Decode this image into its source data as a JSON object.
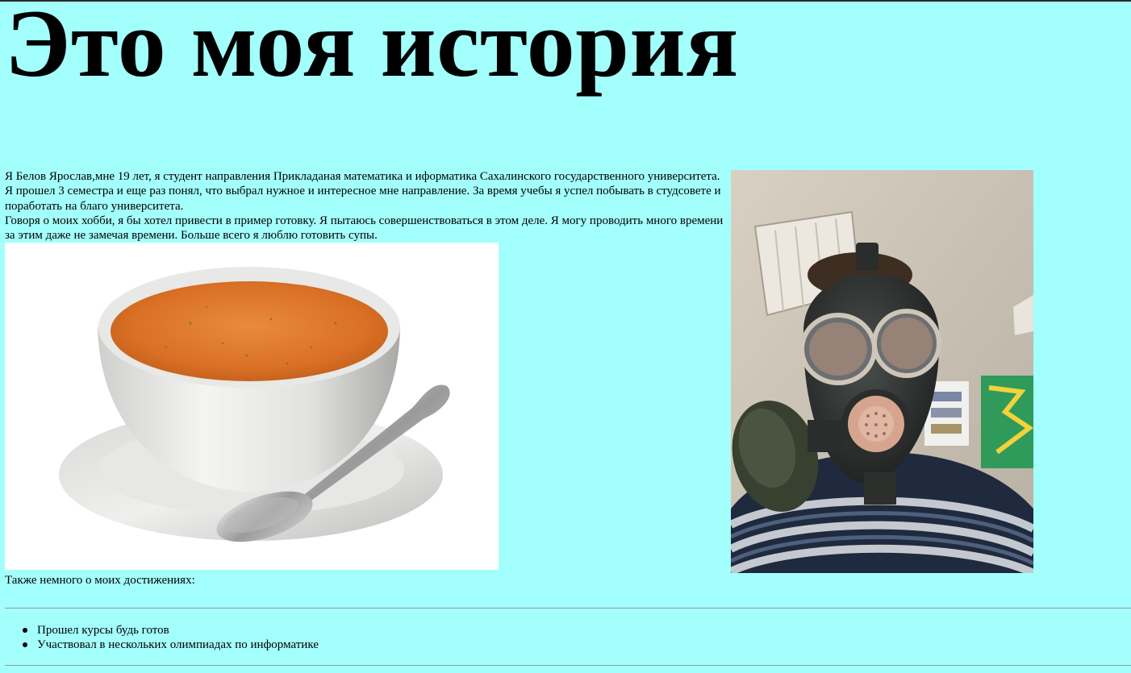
{
  "page": {
    "title": "Это моя история",
    "intro_paragraph_1": "Я Белов Ярослав,мне 19 лет, я студент направления Прикладаная математика и иформатика Сахалинского государственного университета. Я прошел 3 семестра и еще раз понял, что выбрал нужное и интересное мне направление. За время учебы я успел побывать в студсовете и поработать на благо университета.",
    "intro_paragraph_2": "Говоря о моих хобби, я бы хотел привести в пример готовку. Я пытаюсь совершенствоваться в этом деле. Я могу проводить много времени за этим даже не замечая времени. Больше всего я люблю готовить супы.",
    "achievements_intro": "Также немного о моих достижениях:",
    "achievements": [
      "Прошел курсы будь готов",
      "Участвовал в нескольких олимпиадах по информатике"
    ]
  },
  "images": {
    "soup": "soup-bowl-with-spoon-photo",
    "portrait": "person-in-gas-mask-photo"
  },
  "colors": {
    "background": "#a3fffc",
    "text": "#000000",
    "rule": "#9a9a9a"
  }
}
